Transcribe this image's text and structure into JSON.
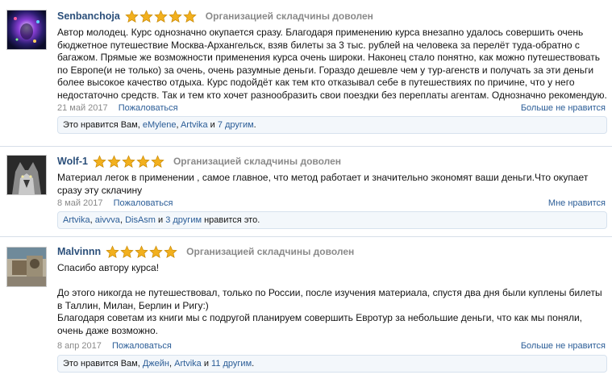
{
  "reviews": [
    {
      "username": "Senbanchoja",
      "rating": 5,
      "rating_label": "Организацией складчины доволен",
      "text": "Автор молодец. Курс однозначно окупается сразу. Благодаря применению курса внезапно удалось совершить очень бюджетное путешествие Москва-Архангельск, взяв билеты за 3 тыс. рублей на человека за перелёт туда-обратно с багажом. Прямые же возможности применения курса очень широки. Наконец стало понятно, как можно путешествовать по Европе(и не только) за очень, очень разумные деньги. Гораздо дешевле чем у тур-агенств и получать за эти деньги более высокое качество отдыха. Курс подойдёт как тем кто отказывал себе в путешествиях по причине, что у него недостаточно средств. Так и тем кто хочет разнообразить свои поездки без переплаты агентам. Однозначно рекомендую.",
      "date": "21 май 2017",
      "report": "Пожаловаться",
      "like_action": "Больше не нравится",
      "likes": {
        "prefix": "Это нравится Вам, ",
        "users": [
          "eMylene",
          "Artvika"
        ],
        "and": " и ",
        "others": "7 другим",
        "suffix": "."
      }
    },
    {
      "username": "Wolf-1",
      "rating": 5,
      "rating_label": "Организацией складчины доволен",
      "text": "Материал легок в применении , самое главное, что метод работает и значительно экономят ваши деньги.Что окупает сразу эту скла­чину",
      "date": "8 май 2017",
      "report": "Пожаловаться",
      "like_action": "Мне нравится",
      "likes": {
        "prefix": "",
        "users": [
          "Artvika",
          "aivvva",
          "DisAsm"
        ],
        "and": " и ",
        "others": "3 другим",
        "suffix": " нравится это."
      }
    },
    {
      "username": "Malvinnn",
      "rating": 5,
      "rating_label": "Организацией складчины доволен",
      "text": "Спасибо автору курса!\n\nДо этого никогда не путешествовал, только по России, после изучения материала, спустя два дня были куплены билеты в Таллин, Милан, Берлин и Ригу:)\nБлагодаря советам из книги мы с подругой планируем совершить Евротур за небольшие деньги, что как мы поняли, очень даже возможно.",
      "date": "8 апр 2017",
      "report": "Пожаловаться",
      "like_action": "Больше не нравится",
      "likes": {
        "prefix": "Это нравится Вам, ",
        "users": [
          "Джейн",
          "Artvika"
        ],
        "and": " и ",
        "others": "11 другим",
        "suffix": "."
      }
    }
  ],
  "colors": {
    "username": "#2b4f7a",
    "link": "#2b5d97",
    "star": "#f2b01e",
    "muted": "#8a8a8a"
  },
  "icons": [
    "star-icon"
  ]
}
